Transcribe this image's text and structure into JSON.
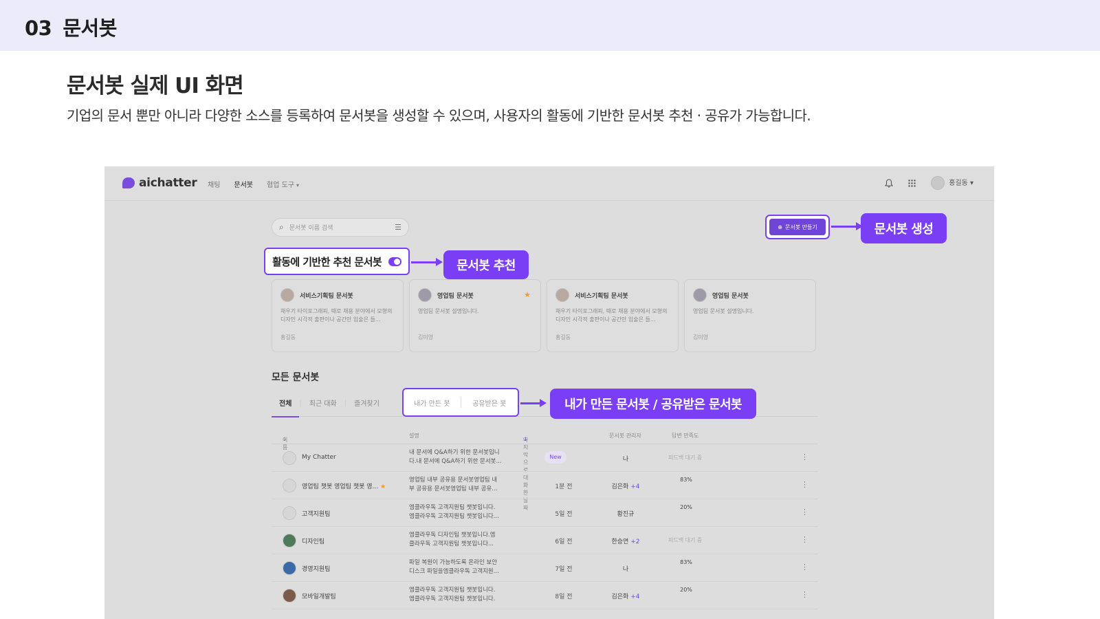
{
  "page": {
    "section_num": "03",
    "section_name": "문서봇",
    "headline": "문서봇 실제 UI 화면",
    "subline": "기업의 문서 뿐만 아니라 다양한 소스를 등록하여 문서봇을 생성할 수 있으며, 사용자의 활동에 기반한 문서봇 추천 · 공유가 가능합니다."
  },
  "app": {
    "logo": "aichatter",
    "nav": [
      "채팅",
      "문서봇",
      "협업 도구"
    ],
    "user": "홍길동",
    "search_placeholder": "문서봇 이름 검색",
    "create_label": "문서봇 만들기",
    "rec_label": "활동에 기반한 추천 문서봇",
    "all_title": "모든 문서봇",
    "tabs": [
      "전체",
      "최근 대화",
      "즐겨찾기"
    ],
    "tabs_framed": [
      "내가 만든 봇",
      "공유받은 봇"
    ],
    "columns": [
      "이름",
      "설명",
      "마지막으로 대화한 날짜",
      "문서봇 관리자",
      "답변 만족도"
    ]
  },
  "callouts": {
    "create": "문서봇 생성",
    "recommend": "문서봇 추천",
    "shared": "내가 만든 문서봇 / 공유받은 문서봇"
  },
  "cards": [
    {
      "name": "서비스기획팀 문서봇",
      "desc": "채우기 타이포그래피, 때로 채용 분야에서 모형의 디자인 시각적 출판이나 공간만 입술은 들...",
      "owner": "홍길동",
      "star": false
    },
    {
      "name": "영업팀 문서봇",
      "desc": "영업팀 문서봇 설명입니다.",
      "owner": "김미영",
      "star": true
    },
    {
      "name": "서비스기획팀 문서봇",
      "desc": "채우기 타이포그래피, 때로 채용 분야에서 모형의 디자인 시각적 출판이나 공간만 입술은 들...",
      "owner": "홍길동",
      "star": false
    },
    {
      "name": "영업팀 문서봇",
      "desc": "영업팀 문서봇 설명입니다.",
      "owner": "김미영",
      "star": false
    }
  ],
  "rows": [
    {
      "name": "My Chatter",
      "star": "",
      "desc1": "내 문서에 Q&A하기 위한 문서봇입니",
      "desc2": "다.내 문서에 Q&A하기 위한 문서봇...",
      "date": "New",
      "mgr": "나",
      "extra": "",
      "satisfaction": "피드백 대기 중",
      "pct": null
    },
    {
      "name": "영업팀 챗봇 영업팀 챗봇 영...",
      "star": "★",
      "desc1": "영업팀 내부 공유용 문서봇영업팀 내",
      "desc2": "부 공유용 문서봇영업팀 내부 공유...",
      "date": "1분 전",
      "mgr": "김은화",
      "extra": "+4",
      "satisfaction": "83%",
      "pct": 83
    },
    {
      "name": "고객지원팀",
      "star": "",
      "desc1": "엠클라우독 고객지원팀 챗봇입니다.",
      "desc2": "엠클라우독 고객지원팀 챗봇입니다...",
      "date": "5일 전",
      "mgr": "황진규",
      "extra": "",
      "satisfaction": "20%",
      "pct": 20
    },
    {
      "name": "디자인팀",
      "star": "",
      "desc1": "엠클라우독 디자인팀 챗봇입니다.엠",
      "desc2": "클라우독 고객지원팀 챗봇입니다...",
      "date": "6일 전",
      "mgr": "한승연",
      "extra": "+2",
      "satisfaction": "피드백 대기 중",
      "pct": null
    },
    {
      "name": "경영지원팀",
      "star": "",
      "desc1": "파일 복원이 가능하도록 온라인 보안",
      "desc2": "디스크 파일을엠클라우독 고객지원...",
      "date": "7일 전",
      "mgr": "나",
      "extra": "",
      "satisfaction": "83%",
      "pct": 83
    },
    {
      "name": "모바일개발팀",
      "star": "",
      "desc1": "엠클라우독 고객지원팀 챗봇입니다.",
      "desc2": "엠클라우독 고객지원팀 챗봇입니다.",
      "date": "8일 전",
      "mgr": "김은화",
      "extra": "+4",
      "satisfaction": "20%",
      "pct": 20
    }
  ],
  "colors": {
    "accent": "#7a3ef5",
    "good": "#6f45d8",
    "bad": "#e0403c",
    "star": "#f0a020"
  }
}
